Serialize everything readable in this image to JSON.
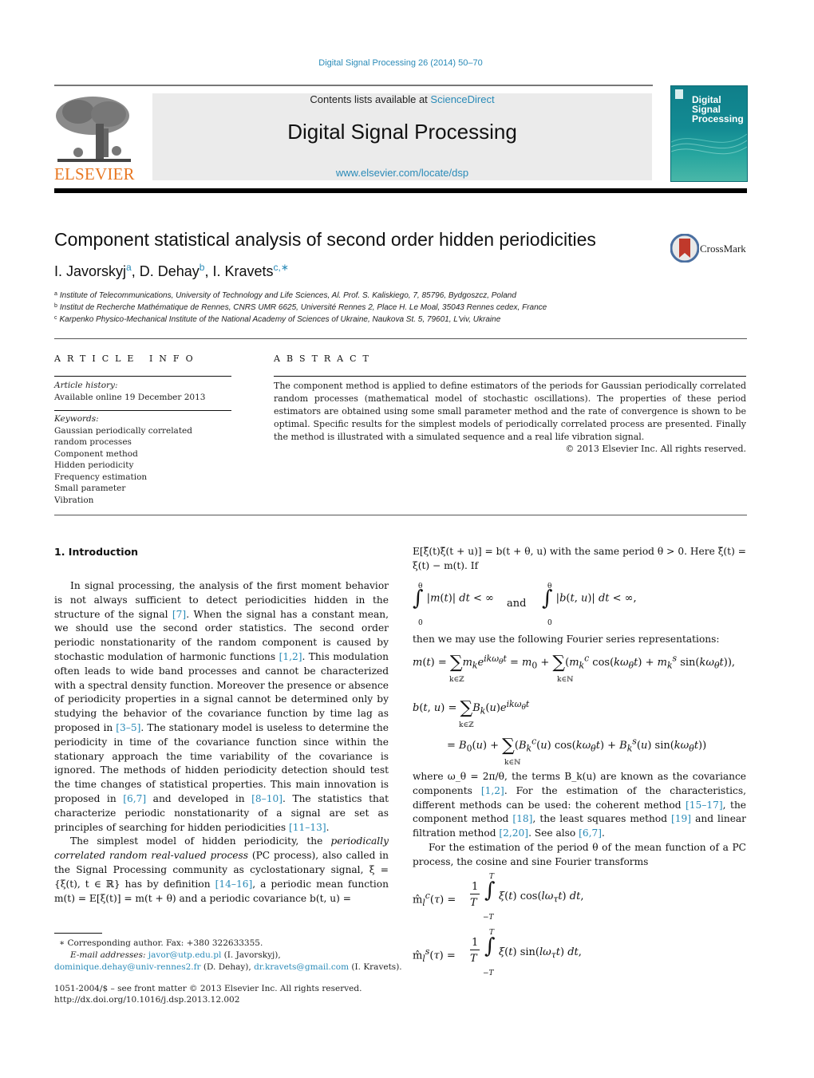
{
  "header": {
    "journal_reference": "Digital Signal Processing 26 (2014) 50–70",
    "contents_prefix": "Contents lists available at ",
    "contents_link": "ScienceDirect",
    "journal_title": "Digital Signal Processing",
    "journal_url": "www.elsevier.com/locate/dsp",
    "publisher_logo_text": "ELSEVIER",
    "cover_title_lines": [
      "Digital",
      "Signal",
      "Processing"
    ],
    "crossmark_label": "CrossMark"
  },
  "article": {
    "title": "Component statistical analysis of second order hidden periodicities",
    "authors": [
      {
        "name": "I. Javorskyj",
        "aff": "a"
      },
      {
        "name": "D. Dehay",
        "aff": "b"
      },
      {
        "name": "I. Kravets",
        "aff": "c,∗"
      }
    ],
    "affiliations": [
      {
        "mark": "a",
        "text": "Institute of Telecommunications, University of Technology and Life Sciences, Al. Prof. S. Kaliskiego, 7, 85796, Bydgoszcz, Poland"
      },
      {
        "mark": "b",
        "text": "Institut de Recherche Mathématique de Rennes, CNRS UMR 6625, Université Rennes 2, Place H. Le Moal, 35043 Rennes cedex, France"
      },
      {
        "mark": "c",
        "text": "Karpenko Physico-Mechanical Institute of the National Academy of Sciences of Ukraine, Naukova St. 5, 79601, L'viv, Ukraine"
      }
    ]
  },
  "article_info": {
    "heading": "ARTICLE INFO",
    "history_label": "Article history:",
    "history_value": "Available online 19 December 2013",
    "keywords_label": "Keywords:",
    "keywords": [
      "Gaussian periodically correlated random processes",
      "Component method",
      "Hidden periodicity",
      "Frequency estimation",
      "Small parameter",
      "Vibration"
    ]
  },
  "abstract": {
    "heading": "ABSTRACT",
    "text": "The component method is applied to define estimators of the periods for Gaussian periodically correlated random processes (mathematical model of stochastic oscillations). The properties of these period estimators are obtained using some small parameter method and the rate of convergence is shown to be optimal. Specific results for the simplest models of periodically correlated process are presented. Finally the method is illustrated with a simulated sequence and a real life vibration signal.",
    "copyright": "© 2013 Elsevier Inc. All rights reserved."
  },
  "section": {
    "heading": "1.  Introduction",
    "p1": [
      {
        "t": "In signal processing, the analysis of the first moment behavior is not always sufficient to detect periodicities hidden in the structure of the signal "
      },
      {
        "ref": "[7]"
      },
      {
        "t": ". When the signal has a constant mean, we should use the second order statistics. The second order periodic nonstationarity of the random component is caused by stochastic modulation of harmonic functions "
      },
      {
        "ref": "[1,2]"
      },
      {
        "t": ". This modulation often leads to wide band processes and cannot be characterized with a spectral density function. Moreover the presence or absence of periodicity properties in a signal cannot be determined only by studying the behavior of the covariance function by time lag as proposed in "
      },
      {
        "ref": "[3–5]"
      },
      {
        "t": ". The stationary model is useless to determine the periodicity in time of the covariance function since within the stationary approach the time variability of the covariance is ignored. The methods of hidden periodicity detection should test the time changes of statistical properties. This main innovation is proposed in "
      },
      {
        "ref": "[6,7]"
      },
      {
        "t": " and developed in "
      },
      {
        "ref": "[8–10]"
      },
      {
        "t": ". The statistics that characterize periodic nonstationarity of a signal are set as principles of searching for hidden periodicities "
      },
      {
        "ref": "[11–13]"
      },
      {
        "t": "."
      }
    ],
    "p2": [
      {
        "t": "The simplest model of hidden periodicity, the "
      },
      {
        "em": "periodically correlated random real-valued process"
      },
      {
        "t": " (PC process), also called in the Signal Processing community as cyclostationary signal, ξ = {ξ(t), t ∈ ℝ} has by definition "
      },
      {
        "ref": "[14–16]"
      },
      {
        "t": ", a periodic mean function m(t) = E[ξ(t)] = m(t + θ) and a periodic covariance b(t, u) ="
      }
    ],
    "right_p1": "E[ξ̄(t)ξ̄(t + u)] = b(t + θ, u) with the same period θ > 0. Here ξ̄(t) = ξ(t) − m(t). If",
    "integral_conj": "and",
    "right_p2": "then we may use the following Fourier series representations:",
    "right_p3": [
      {
        "t": "where ω_θ = 2π/θ, the terms B_k(u) are known as the covariance components "
      },
      {
        "ref": "[1,2]"
      },
      {
        "t": ". For the estimation of the characteristics, different methods can be used: the coherent method "
      },
      {
        "ref": "[15–17]"
      },
      {
        "t": ", the component method "
      },
      {
        "ref": "[18]"
      },
      {
        "t": ", the least squares method "
      },
      {
        "ref": "[19]"
      },
      {
        "t": " and linear filtration method "
      },
      {
        "ref": "[2,20]"
      },
      {
        "t": ". See also "
      },
      {
        "ref": "[6,7]"
      },
      {
        "t": "."
      }
    ],
    "right_p4": "For the estimation of the period θ of the mean function of a PC process, the cosine and sine Fourier transforms"
  },
  "footnotes": {
    "corresponding": "∗  Corresponding author. Fax: +380 322633355.",
    "email_label": "E-mail addresses:",
    "emails": [
      {
        "addr": "javor@utp.edu.pl",
        "who": " (I. Javorskyj),"
      },
      {
        "addr": "dominique.dehay@univ-rennes2.fr",
        "who": " (D. Dehay), "
      },
      {
        "addr": "dr.kravets@gmail.com",
        "who": " (I. Kravets)."
      }
    ],
    "issn_line": "1051-2004/$ – see front matter  © 2013 Elsevier Inc. All rights reserved.",
    "doi": "http://dx.doi.org/10.1016/j.dsp.2013.12.002"
  },
  "colors": {
    "link": "#2a8bb8",
    "elsevier_orange": "#e87722",
    "cover_teal": "#138b93"
  }
}
